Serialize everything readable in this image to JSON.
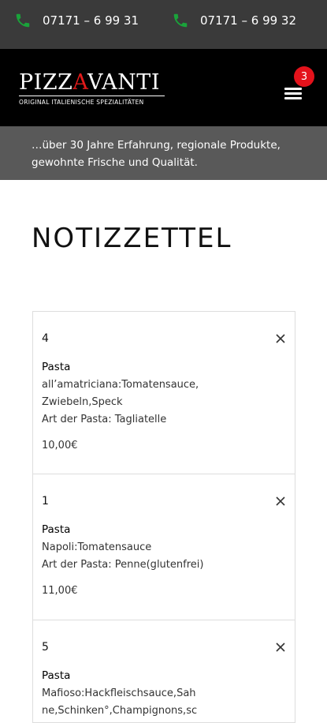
{
  "phones": [
    "07171 – 6 99 31",
    "07171 – 6 99 32"
  ],
  "logo": {
    "title_pre": "PIZZ",
    "title_accent": "A",
    "title_post": "VANTI",
    "subtitle": "ORIGINAL ITALIENISCHE SPEZIALITÄTEN"
  },
  "cart_count": "3",
  "banner": {
    "line1": "…über 30 Jahre Erfahrung, regionale Produkte,",
    "line2": "gewohnte Frische und Qualität."
  },
  "page_title": "NOTIZZETTEL",
  "items": [
    {
      "qty": "4",
      "category": "Pasta",
      "desc_lines": [
        "all’amatriciana:Tomatensauce,",
        "Zwiebeln,Speck",
        "Art der Pasta: Tagliatelle"
      ],
      "price": "10,00€"
    },
    {
      "qty": "1",
      "category": "Pasta",
      "desc_lines": [
        "Napoli:Tomatensauce",
        "Art der Pasta: Penne(glutenfrei)"
      ],
      "price": "11,00€"
    },
    {
      "qty": "5",
      "category": "Pasta",
      "desc_lines": [
        "Mafioso:Hackfleischsauce,Sah",
        "ne,Schinken°,Champignons,sc"
      ],
      "price": ""
    }
  ]
}
